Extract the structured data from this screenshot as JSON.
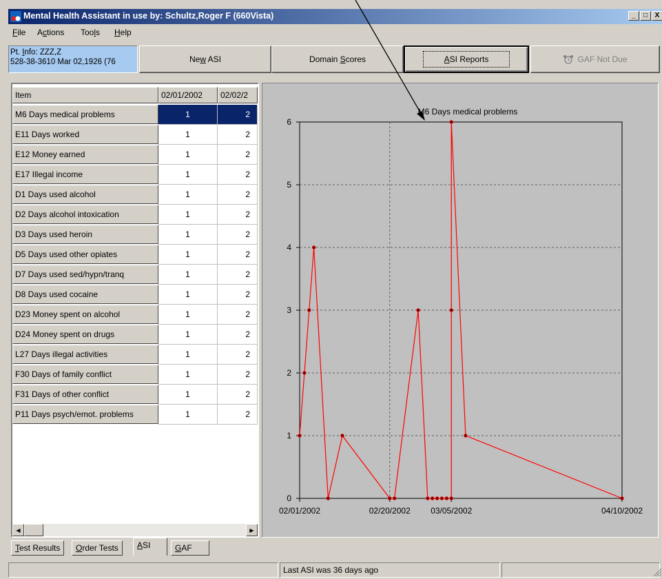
{
  "window": {
    "title": "Mental Health Assistant in use by: Schultz,Roger F  (660Vista)",
    "app_icon": "mha-app-icon",
    "controls": [
      "_",
      "□",
      "X"
    ]
  },
  "menu": [
    {
      "label": "File",
      "accel": "F",
      "rest": "ile"
    },
    {
      "label": "Actions",
      "pre": "A",
      "accel": "c",
      "rest": "tions"
    },
    {
      "label": "Tools",
      "pre": "Too",
      "accel": "l",
      "rest": "s"
    },
    {
      "label": "Help",
      "accel": "H",
      "rest": "elp"
    }
  ],
  "patient": {
    "line1_pre": "Pt. ",
    "line1_accel": "I",
    "line1_rest": "nfo: ZZZ,Z",
    "line2": "528-38-3610  Mar 02,1926 (76"
  },
  "toolbar": {
    "new_asi": {
      "pre": "Ne",
      "accel": "w",
      "rest": " ASI"
    },
    "domain_scores": {
      "pre": "Domain ",
      "accel": "S",
      "rest": "cores"
    },
    "asi_reports": {
      "pre": "",
      "accel": "A",
      "rest": "SI Reports"
    },
    "gaf": "GAF Not Due",
    "gaf_icon": "gaf-clock-icon"
  },
  "grid": {
    "headers": [
      "Item",
      "02/01/2002",
      "02/02/2"
    ],
    "rows": [
      {
        "label": "M6 Days medical problems",
        "v1": "1",
        "v2": "2"
      },
      {
        "label": "E11 Days worked",
        "v1": "1",
        "v2": "2"
      },
      {
        "label": "E12 Money earned",
        "v1": "1",
        "v2": "2"
      },
      {
        "label": "E17 Illegal income",
        "v1": "1",
        "v2": "2"
      },
      {
        "label": "D1 Days used alcohol",
        "v1": "1",
        "v2": "2"
      },
      {
        "label": "D2 Days alcohol intoxication",
        "v1": "1",
        "v2": "2"
      },
      {
        "label": "D3 Days used heroin",
        "v1": "1",
        "v2": "2"
      },
      {
        "label": "D5 Days used other opiates",
        "v1": "1",
        "v2": "2"
      },
      {
        "label": "D7 Days used sed/hypn/tranq",
        "v1": "1",
        "v2": "2"
      },
      {
        "label": "D8 Days used cocaine",
        "v1": "1",
        "v2": "2"
      },
      {
        "label": "D23 Money spent on alcohol",
        "v1": "1",
        "v2": "2"
      },
      {
        "label": "D24 Money spent on drugs",
        "v1": "1",
        "v2": "2"
      },
      {
        "label": "L27 Days illegal activities",
        "v1": "1",
        "v2": "2"
      },
      {
        "label": "F30 Days of family conflict",
        "v1": "1",
        "v2": "2"
      },
      {
        "label": "F31 Days of other conflict",
        "v1": "1",
        "v2": "2"
      },
      {
        "label": "P11 Days psych/emot. problems",
        "v1": "1",
        "v2": "2"
      }
    ]
  },
  "tabs": [
    {
      "accel": "T",
      "rest": "est Results"
    },
    {
      "accel": "O",
      "rest": "rder Tests"
    },
    {
      "accel": "A",
      "rest": "SI",
      "active": true
    },
    {
      "accel": "G",
      "rest": "AF"
    }
  ],
  "status": {
    "message": "Last ASI was 36 days ago"
  },
  "chart_data": {
    "type": "line",
    "title": "M6 Days medical problems",
    "color": "#ff0000",
    "marker_color": "#800000",
    "grid": true,
    "ylim": [
      0,
      6
    ],
    "yticks": [
      "0",
      "1",
      "2",
      "3",
      "4",
      "5",
      "6"
    ],
    "xticks": [
      "02/01/2002",
      "02/20/2002",
      "03/05/2002",
      "04/10/2002"
    ],
    "x": [
      "2002-02-01",
      "2002-02-02",
      "2002-02-03",
      "2002-02-04",
      "2002-02-07",
      "2002-02-10",
      "2002-02-20",
      "2002-02-21",
      "2002-02-26",
      "2002-02-28",
      "2002-03-01",
      "2002-03-02",
      "2002-03-03",
      "2002-03-04",
      "2002-03-05",
      "2002-03-05",
      "2002-03-05",
      "2002-03-08",
      "2002-04-10"
    ],
    "values": [
      1,
      2,
      3,
      4,
      0,
      1,
      0,
      0,
      3,
      0,
      0,
      0,
      0,
      0,
      0,
      3,
      6,
      1,
      0
    ]
  }
}
